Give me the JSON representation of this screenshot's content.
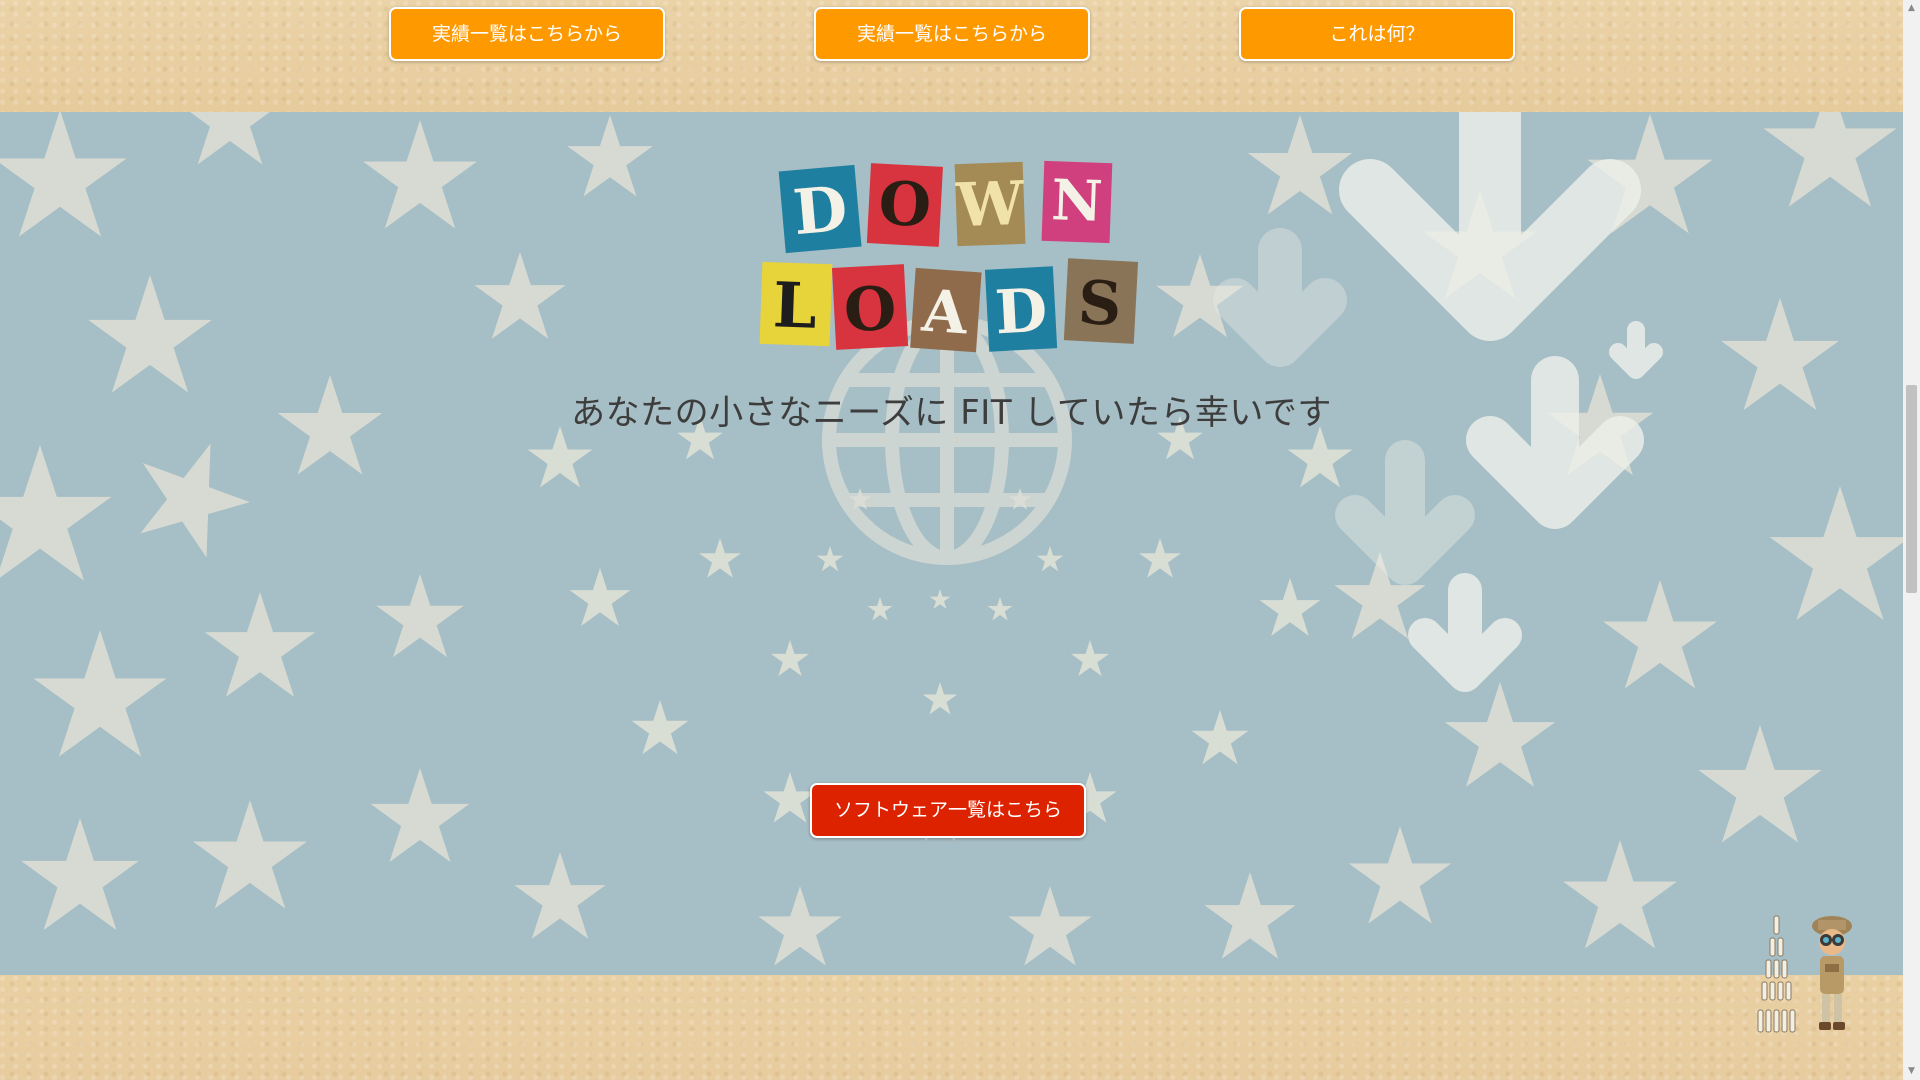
{
  "top_buttons": [
    {
      "label": "実績一覧はこちらから"
    },
    {
      "label": "実績一覧はこちらから"
    },
    {
      "label": "これは何？"
    }
  ],
  "downloads": {
    "logo_letters": [
      "D",
      "O",
      "W",
      "N",
      "L",
      "O",
      "A",
      "D",
      "S"
    ],
    "tagline": "あなたの小さなニーズに FIT していたら幸いです",
    "software_button": "ソフトウェア一覧はこちら"
  },
  "colors": {
    "orange_button": "#ff9900",
    "red_button": "#dd2200",
    "kraft_bg": "#e8cfa4",
    "star_bg": "#a9c0c6"
  },
  "icons": [
    "globe-icon",
    "down-arrow-icon",
    "binocular-explorer-mascot"
  ]
}
